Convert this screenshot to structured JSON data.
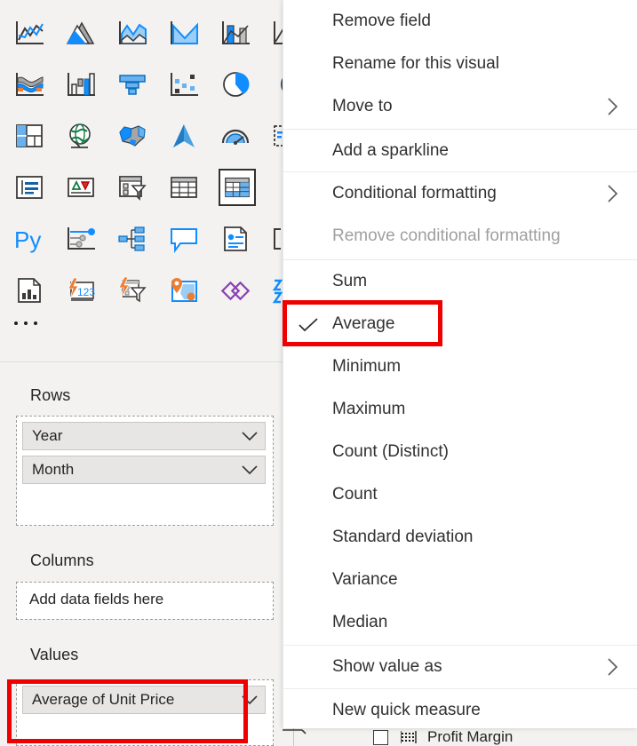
{
  "visualizations_pane": {
    "icon_rows": [
      [
        {
          "name": "line-chart-icon",
          "label": "Line chart"
        },
        {
          "name": "area-chart-icon",
          "label": "Area chart"
        },
        {
          "name": "stacked-area-chart-icon",
          "label": "Stacked area chart"
        },
        {
          "name": "filled-area-chart-icon",
          "label": "Area chart"
        },
        {
          "name": "line-and-stacked-column-chart-icon",
          "label": "Line and stacked column chart"
        },
        {
          "name": "line-and-clustered-column-chart-icon",
          "label": "Line and clustered column chart"
        }
      ],
      [
        {
          "name": "ribbon-chart-icon",
          "label": "Ribbon chart"
        },
        {
          "name": "waterfall-chart-icon",
          "label": "Waterfall chart"
        },
        {
          "name": "funnel-chart-icon",
          "label": "Funnel chart"
        },
        {
          "name": "scatter-chart-icon",
          "label": "Scatter chart"
        },
        {
          "name": "pie-chart-icon",
          "label": "Pie chart"
        },
        {
          "name": "donut-chart-icon",
          "label": "Donut chart"
        }
      ],
      [
        {
          "name": "treemap-icon",
          "label": "Treemap"
        },
        {
          "name": "map-icon",
          "label": "Map"
        },
        {
          "name": "filled-map-icon",
          "label": "Filled map"
        },
        {
          "name": "azure-map-icon",
          "label": "Azure map"
        },
        {
          "name": "gauge-icon",
          "label": "Gauge"
        },
        {
          "name": "card-icon",
          "label": "Card"
        }
      ],
      [
        {
          "name": "multi-row-card-icon",
          "label": "Multi-row card"
        },
        {
          "name": "kpi-icon",
          "label": "KPI"
        },
        {
          "name": "slicer-icon",
          "label": "Slicer"
        },
        {
          "name": "table-icon",
          "label": "Table"
        },
        {
          "name": "matrix-icon",
          "label": "Matrix",
          "selected": true
        }
      ],
      [
        {
          "name": "python-visual-icon",
          "label": "Py"
        },
        {
          "name": "r-script-visual-icon",
          "label": "R script visual"
        },
        {
          "name": "decomposition-tree-icon",
          "label": "Decomposition tree"
        },
        {
          "name": "qanda-visual-icon",
          "label": "Q&A"
        },
        {
          "name": "smart-narrative-icon",
          "label": "Smart narrative"
        },
        {
          "name": "metrics-icon",
          "label": "Metrics"
        }
      ],
      [
        {
          "name": "paginated-report-icon",
          "label": "Paginated report"
        },
        {
          "name": "power-apps-visual-icon",
          "label": "Power Apps for Power BI"
        },
        {
          "name": "power-automate-visual-icon",
          "label": "Power Automate for Power BI"
        },
        {
          "name": "arcgis-map-icon",
          "label": "ArcGIS Maps for Power BI"
        },
        {
          "name": "deneb-visual-icon",
          "label": "Deneb"
        },
        {
          "name": "custom-visual-icon",
          "label": "Custom visual"
        }
      ]
    ],
    "more_options_label": "..."
  },
  "field_wells": {
    "rows": {
      "title": "Rows",
      "fields": [
        {
          "label": "Year"
        },
        {
          "label": "Month"
        }
      ]
    },
    "columns": {
      "title": "Columns",
      "placeholder": "Add data fields here",
      "fields": []
    },
    "values": {
      "title": "Values",
      "fields": [
        {
          "label": "Average of Unit Price",
          "highlighted": true
        }
      ]
    }
  },
  "context_menu": {
    "items": [
      {
        "label": "Remove field",
        "submenu": false,
        "checked": false,
        "disabled": false
      },
      {
        "label": "Rename for this visual",
        "submenu": false,
        "checked": false,
        "disabled": false
      },
      {
        "label": "Move to",
        "submenu": true,
        "checked": false,
        "disabled": false
      },
      {
        "label": "Add a sparkline",
        "submenu": false,
        "checked": false,
        "disabled": false
      },
      {
        "label": "Conditional formatting",
        "submenu": true,
        "checked": false,
        "disabled": false
      },
      {
        "label": "Remove conditional formatting",
        "submenu": false,
        "checked": false,
        "disabled": true
      },
      {
        "label": "Sum",
        "submenu": false,
        "checked": false,
        "disabled": false
      },
      {
        "label": "Average",
        "submenu": false,
        "checked": true,
        "disabled": false,
        "highlighted": true
      },
      {
        "label": "Minimum",
        "submenu": false,
        "checked": false,
        "disabled": false
      },
      {
        "label": "Maximum",
        "submenu": false,
        "checked": false,
        "disabled": false
      },
      {
        "label": "Count (Distinct)",
        "submenu": false,
        "checked": false,
        "disabled": false
      },
      {
        "label": "Count",
        "submenu": false,
        "checked": false,
        "disabled": false
      },
      {
        "label": "Standard deviation",
        "submenu": false,
        "checked": false,
        "disabled": false
      },
      {
        "label": "Variance",
        "submenu": false,
        "checked": false,
        "disabled": false
      },
      {
        "label": "Median",
        "submenu": false,
        "checked": false,
        "disabled": false
      },
      {
        "label": "Show value as",
        "submenu": true,
        "checked": false,
        "disabled": false
      },
      {
        "label": "New quick measure",
        "submenu": false,
        "checked": false,
        "disabled": false
      }
    ]
  },
  "background_fields_list": {
    "partial_item_label": "Profit Margin"
  },
  "colors": {
    "annotation_red": "#ee0000",
    "pane_background": "#f3f2f1",
    "menu_background": "#ffffff",
    "accent_blue": "#118dff",
    "text_primary": "#252423",
    "text_disabled": "#a19f9d"
  }
}
